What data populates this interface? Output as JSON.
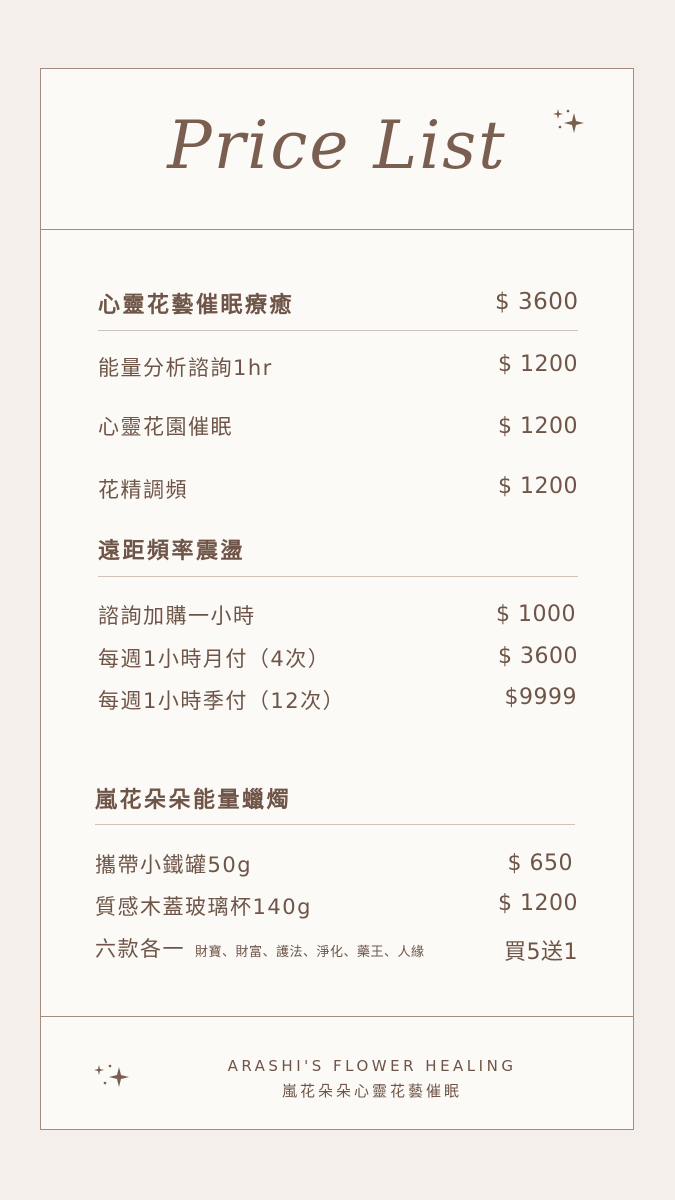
{
  "header": {
    "title": "Price List",
    "sparkle_icon": "sparkle-icon"
  },
  "sections": [
    {
      "title": "心靈花藝催眠療癒",
      "price": "$ 3600",
      "items": [
        {
          "name": "能量分析諮詢1hr",
          "price": "$ 1200"
        },
        {
          "name": "心靈花園催眠",
          "price": "$ 1200"
        },
        {
          "name": "花精調頻",
          "price": "$ 1200"
        }
      ]
    },
    {
      "title": "遠距頻率震盪",
      "items": [
        {
          "name": "諮詢加購一小時",
          "price": "$ 1000"
        },
        {
          "name": "每週1小時月付（4次）",
          "price": "$ 3600"
        },
        {
          "name": "每週1小時季付（12次）",
          "price": "$9999"
        }
      ]
    },
    {
      "title": "嵐花朵朵能量蠟燭",
      "items": [
        {
          "name": "攜帶小鐵罐50g",
          "price": "$ 650"
        },
        {
          "name": "質感木蓋玻璃杯140g",
          "price": "$ 1200"
        },
        {
          "name": "六款各一",
          "note": "財寶、財富、護法、淨化、藥王、人緣",
          "price": "買5送1"
        }
      ]
    }
  ],
  "footer": {
    "brand_en": "ARASHI'S FLOWER HEALING",
    "brand_zh": "嵐花朵朵心靈花藝催眠"
  }
}
